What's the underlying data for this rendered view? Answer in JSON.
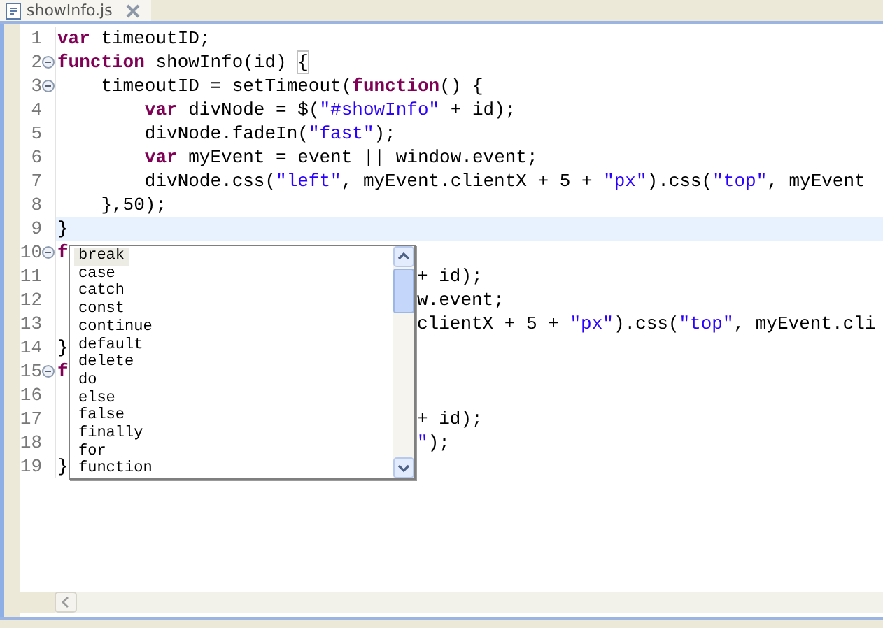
{
  "tab": {
    "title": "showInfo.js",
    "selected": true
  },
  "lines": [
    {
      "number": "1",
      "collapsible": false,
      "current": false,
      "tokens": [
        {
          "kind": "kw",
          "text": "var"
        },
        {
          "kind": "plain",
          "text": " timeoutID;"
        }
      ]
    },
    {
      "number": "2",
      "collapsible": true,
      "current": false,
      "tokens": [
        {
          "kind": "kw",
          "text": "function"
        },
        {
          "kind": "plain",
          "text": " showInfo(id) "
        },
        {
          "kind": "match",
          "text": "{"
        }
      ]
    },
    {
      "number": "3",
      "collapsible": true,
      "current": false,
      "tokens": [
        {
          "kind": "plain",
          "text": "    timeoutID = setTimeout("
        },
        {
          "kind": "kw",
          "text": "function"
        },
        {
          "kind": "plain",
          "text": "() {"
        }
      ]
    },
    {
      "number": "4",
      "collapsible": false,
      "current": false,
      "tokens": [
        {
          "kind": "kw",
          "text": "        var"
        },
        {
          "kind": "plain",
          "text": " divNode = $("
        },
        {
          "kind": "str",
          "text": "\"#showInfo\""
        },
        {
          "kind": "plain",
          "text": " + id);"
        }
      ]
    },
    {
      "number": "5",
      "collapsible": false,
      "current": false,
      "tokens": [
        {
          "kind": "plain",
          "text": "        divNode.fadeIn("
        },
        {
          "kind": "str",
          "text": "\"fast\""
        },
        {
          "kind": "plain",
          "text": ");"
        }
      ]
    },
    {
      "number": "6",
      "collapsible": false,
      "current": false,
      "tokens": [
        {
          "kind": "kw",
          "text": "        var"
        },
        {
          "kind": "plain",
          "text": " myEvent = event || window.event;"
        }
      ]
    },
    {
      "number": "7",
      "collapsible": false,
      "current": false,
      "tokens": [
        {
          "kind": "plain",
          "text": "        divNode.css("
        },
        {
          "kind": "str",
          "text": "\"left\""
        },
        {
          "kind": "plain",
          "text": ", myEvent.clientX + 5 + "
        },
        {
          "kind": "str",
          "text": "\"px\""
        },
        {
          "kind": "plain",
          "text": ").css("
        },
        {
          "kind": "str",
          "text": "\"top\""
        },
        {
          "kind": "plain",
          "text": ", myEvent"
        }
      ]
    },
    {
      "number": "8",
      "collapsible": false,
      "current": false,
      "tokens": [
        {
          "kind": "plain",
          "text": "    },50);"
        }
      ]
    },
    {
      "number": "9",
      "collapsible": false,
      "current": true,
      "tokens": [
        {
          "kind": "plain",
          "text": "}"
        }
      ]
    },
    {
      "number": "10",
      "collapsible": true,
      "current": false,
      "tokens": [
        {
          "kind": "kw",
          "text": "f"
        }
      ]
    },
    {
      "number": "11",
      "collapsible": false,
      "current": false,
      "tail": [
        {
          "kind": "plain",
          "text": "+ id);"
        }
      ]
    },
    {
      "number": "12",
      "collapsible": false,
      "current": false,
      "tail": [
        {
          "kind": "plain",
          "text": "w.event;"
        }
      ]
    },
    {
      "number": "13",
      "collapsible": false,
      "current": false,
      "tail": [
        {
          "kind": "plain",
          "text": "clientX + 5 + "
        },
        {
          "kind": "str",
          "text": "\"px\""
        },
        {
          "kind": "plain",
          "text": ").css("
        },
        {
          "kind": "str",
          "text": "\"top\""
        },
        {
          "kind": "plain",
          "text": ", myEvent.cli"
        }
      ]
    },
    {
      "number": "14",
      "collapsible": false,
      "current": false,
      "tokens": [
        {
          "kind": "plain",
          "text": "}"
        }
      ]
    },
    {
      "number": "15",
      "collapsible": true,
      "current": false,
      "tokens": [
        {
          "kind": "kw",
          "text": "f"
        }
      ]
    },
    {
      "number": "16",
      "collapsible": false,
      "current": false
    },
    {
      "number": "17",
      "collapsible": false,
      "current": false,
      "tail": [
        {
          "kind": "plain",
          "text": "+ id);"
        }
      ]
    },
    {
      "number": "18",
      "collapsible": false,
      "current": false,
      "tail": [
        {
          "kind": "str",
          "text": "\""
        },
        {
          "kind": "plain",
          "text": ");"
        }
      ]
    },
    {
      "number": "19",
      "collapsible": false,
      "current": false,
      "tokens": [
        {
          "kind": "plain",
          "text": "}"
        }
      ]
    }
  ],
  "completion": {
    "items": [
      {
        "label": "break",
        "selected": true
      },
      {
        "label": "case",
        "selected": false
      },
      {
        "label": "catch",
        "selected": false
      },
      {
        "label": "const",
        "selected": false
      },
      {
        "label": "continue",
        "selected": false
      },
      {
        "label": "default",
        "selected": false
      },
      {
        "label": "delete",
        "selected": false
      },
      {
        "label": "do",
        "selected": false
      },
      {
        "label": "else",
        "selected": false
      },
      {
        "label": "false",
        "selected": false
      },
      {
        "label": "finally",
        "selected": false
      },
      {
        "label": "for",
        "selected": false
      },
      {
        "label": "function",
        "selected": false
      }
    ]
  }
}
